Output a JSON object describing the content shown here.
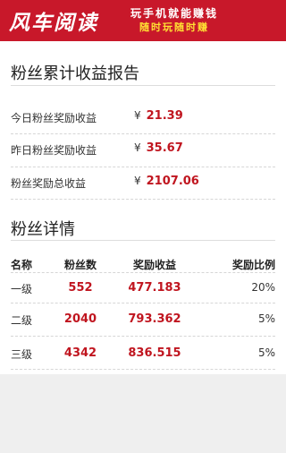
{
  "banner": {
    "brand": "风车阅读",
    "slogan_line1": "玩手机就能赚钱",
    "slogan_line2": "随时玩随时赚",
    "colors": {
      "background": "#c8182a",
      "slogan_highlight": "#ffe033"
    }
  },
  "earnings_report": {
    "title": "粉丝累计收益报告",
    "currency_symbol": "¥",
    "rows": [
      {
        "label": "今日粉丝奖励收益",
        "value": "21.39"
      },
      {
        "label": "昨日粉丝奖励收益",
        "value": "35.67"
      },
      {
        "label": "粉丝奖励总收益",
        "value": "2107.06"
      }
    ]
  },
  "fans_detail": {
    "title": "粉丝详情",
    "columns": [
      "名称",
      "粉丝数",
      "奖励收益",
      "奖励比例"
    ],
    "rows": [
      {
        "level": "一级",
        "fans": "552",
        "reward": "477.183",
        "ratio": "20%"
      },
      {
        "level": "二级",
        "fans": "2040",
        "reward": "793.362",
        "ratio": "5%"
      },
      {
        "level": "三级",
        "fans": "4342",
        "reward": "836.515",
        "ratio": "5%"
      }
    ]
  },
  "colors": {
    "accent": "#c0151f",
    "page_background": "#efefef"
  }
}
